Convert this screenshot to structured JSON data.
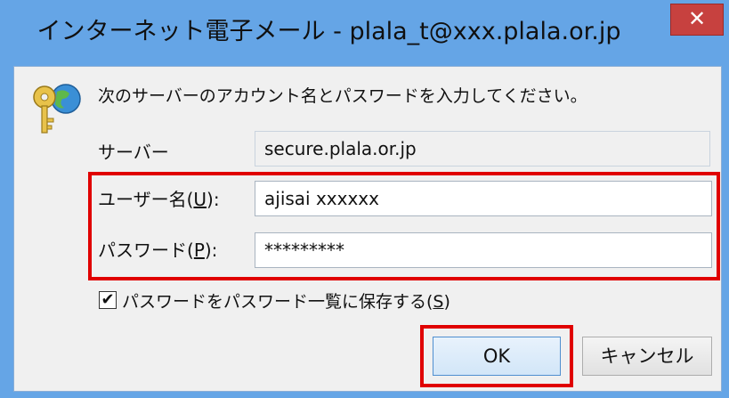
{
  "window": {
    "title": "インターネット電子メール - plala_t@xxx.plala.or.jp",
    "close_glyph": "✕"
  },
  "prompt": "次のサーバーのアカウント名とパスワードを入力してください。",
  "server": {
    "label": "サーバー",
    "value": "secure.plala.or.jp"
  },
  "username": {
    "label_prefix": "ユーザー名(",
    "access_key": "U",
    "label_suffix": "):",
    "value": "ajisai xxxxxx"
  },
  "password": {
    "label_prefix": "パスワード(",
    "access_key": "P",
    "label_suffix": "):",
    "value": "*********"
  },
  "save_password": {
    "checked": true,
    "check_glyph": "✔",
    "label_prefix": "パスワードをパスワード一覧に保存する(",
    "access_key": "S",
    "label_suffix": ")"
  },
  "buttons": {
    "ok": "OK",
    "cancel": "キャンセル"
  },
  "colors": {
    "highlight": "#e00000",
    "titlebar": "#65a5e6",
    "close": "#c7413f"
  }
}
